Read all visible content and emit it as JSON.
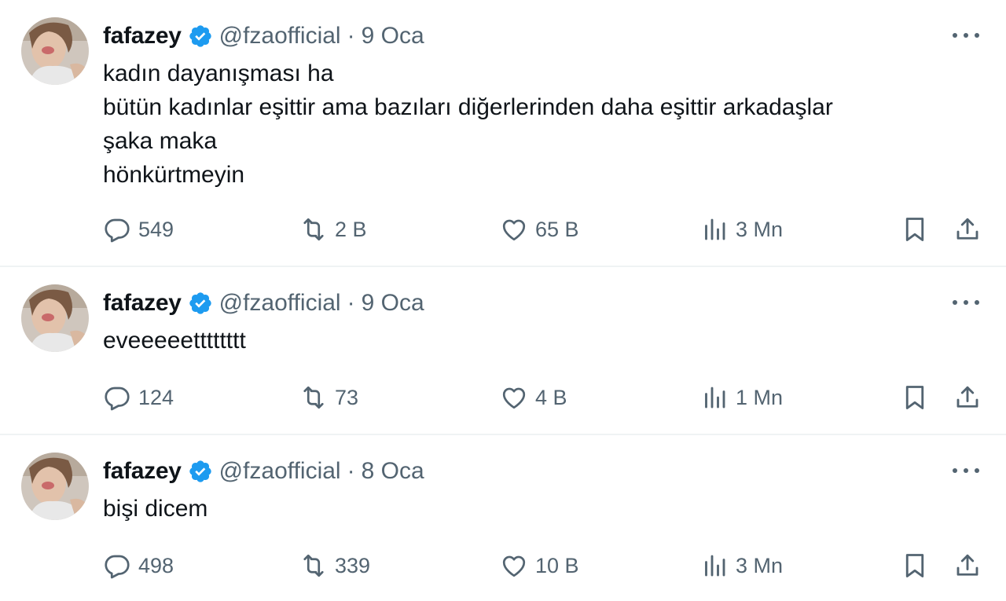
{
  "tweets": [
    {
      "author": {
        "name": "fafazey",
        "handle": "@fzaofficial",
        "avatar_icon": "avatar"
      },
      "date": "9 Oca",
      "separator": "·",
      "lines": [
        "kadın dayanışması ha",
        "bütün kadınlar eşittir ama bazıları diğerlerinden daha eşittir arkadaşlar",
        "şaka maka",
        "hönkürtmeyin"
      ],
      "stats": {
        "replies": "549",
        "reposts": "2 B",
        "likes": "65 B",
        "views": "3 Mn"
      }
    },
    {
      "author": {
        "name": "fafazey",
        "handle": "@fzaofficial",
        "avatar_icon": "avatar"
      },
      "date": "9 Oca",
      "separator": "·",
      "lines": [
        "eveeeeetttttttt"
      ],
      "stats": {
        "replies": "124",
        "reposts": "73",
        "likes": "4 B",
        "views": "1 Mn"
      }
    },
    {
      "author": {
        "name": "fafazey",
        "handle": "@fzaofficial",
        "avatar_icon": "avatar"
      },
      "date": "8 Oca",
      "separator": "·",
      "lines": [
        "bişi dicem"
      ],
      "stats": {
        "replies": "498",
        "reposts": "339",
        "likes": "10 B",
        "views": "3 Mn"
      }
    }
  ],
  "icons": {
    "verified": "verified-badge-icon",
    "more": "more-options-icon",
    "reply": "reply-icon",
    "repost": "repost-icon",
    "like": "heart-icon",
    "views": "views-icon",
    "bookmark": "bookmark-icon",
    "share": "share-icon"
  },
  "colors": {
    "text_primary": "#0f1419",
    "text_secondary": "#536471",
    "verified_blue": "#1d9bf0",
    "divider": "#eff3f4"
  }
}
